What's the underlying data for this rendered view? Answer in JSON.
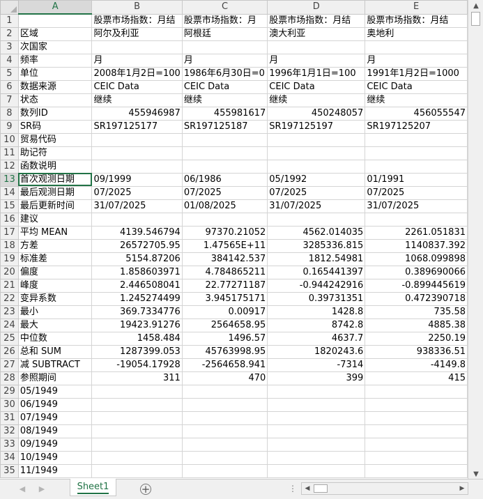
{
  "columns": [
    "A",
    "B",
    "C",
    "D",
    "E"
  ],
  "selected_column": "A",
  "selected_row": 13,
  "rows": [
    {
      "n": "1",
      "a": "",
      "b": "股票市场指数：月结",
      "c": "股票市场指数：月",
      "d": "股票市场指数：月结",
      "e": "股票市场指数：月结"
    },
    {
      "n": "2",
      "a": "区域",
      "b": "阿尔及利亚",
      "c": "阿根廷",
      "d": "澳大利亚",
      "e": "奥地利"
    },
    {
      "n": "3",
      "a": "次国家",
      "b": "",
      "c": "",
      "d": "",
      "e": ""
    },
    {
      "n": "4",
      "a": "频率",
      "b": "月",
      "c": "月",
      "d": "月",
      "e": "月"
    },
    {
      "n": "5",
      "a": "单位",
      "b": "2008年1月2日=100",
      "c": "1986年6月30日=0",
      "d": "1996年1月1日=100",
      "e": "1991年1月2日=1000"
    },
    {
      "n": "6",
      "a": "数据来源",
      "b": "CEIC Data",
      "c": "CEIC Data",
      "d": "CEIC Data",
      "e": "CEIC Data"
    },
    {
      "n": "7",
      "a": "状态",
      "b": "继续",
      "c": "继续",
      "d": "继续",
      "e": "继续"
    },
    {
      "n": "8",
      "a": "数列ID",
      "b": "455946987",
      "c": "455981617",
      "d": "450248057",
      "e": "456055547",
      "num": true
    },
    {
      "n": "9",
      "a": "SR码",
      "b": "SR197125177",
      "c": "SR197125187",
      "d": "SR197125197",
      "e": "SR197125207"
    },
    {
      "n": "10",
      "a": "贸易代码",
      "b": "",
      "c": "",
      "d": "",
      "e": ""
    },
    {
      "n": "11",
      "a": "助记符",
      "b": "",
      "c": "",
      "d": "",
      "e": ""
    },
    {
      "n": "12",
      "a": "函数说明",
      "b": "",
      "c": "",
      "d": "",
      "e": ""
    },
    {
      "n": "13",
      "a": "首次观测日期",
      "b": "09/1999",
      "c": "06/1986",
      "d": "05/1992",
      "e": "01/1991"
    },
    {
      "n": "14",
      "a": "最后观测日期",
      "b": "07/2025",
      "c": "07/2025",
      "d": "07/2025",
      "e": "07/2025"
    },
    {
      "n": "15",
      "a": "最后更新时间",
      "b": "31/07/2025",
      "c": "01/08/2025",
      "d": "31/07/2025",
      "e": "31/07/2025"
    },
    {
      "n": "16",
      "a": "建议",
      "b": "",
      "c": "",
      "d": "",
      "e": ""
    },
    {
      "n": "17",
      "a": "平均 MEAN",
      "b": "4139.546794",
      "c": "97370.21052",
      "d": "4562.014035",
      "e": "2261.051831",
      "num": true
    },
    {
      "n": "18",
      "a": "方差",
      "b": "26572705.95",
      "c": "1.47565E+11",
      "d": "3285336.815",
      "e": "1140837.392",
      "num": true
    },
    {
      "n": "19",
      "a": "标准差",
      "b": "5154.87206",
      "c": "384142.537",
      "d": "1812.54981",
      "e": "1068.099898",
      "num": true
    },
    {
      "n": "20",
      "a": "偏度",
      "b": "1.858603971",
      "c": "4.784865211",
      "d": "0.165441397",
      "e": "0.389690066",
      "num": true
    },
    {
      "n": "21",
      "a": "峰度",
      "b": "2.446508041",
      "c": "22.77271187",
      "d": "-0.944242916",
      "e": "-0.899445619",
      "num": true
    },
    {
      "n": "22",
      "a": "变异系数",
      "b": "1.245274499",
      "c": "3.945175171",
      "d": "0.39731351",
      "e": "0.472390718",
      "num": true
    },
    {
      "n": "23",
      "a": "最小",
      "b": "369.7334776",
      "c": "0.00917",
      "d": "1428.8",
      "e": "735.58",
      "num": true
    },
    {
      "n": "24",
      "a": "最大",
      "b": "19423.91276",
      "c": "2564658.95",
      "d": "8742.8",
      "e": "4885.38",
      "num": true
    },
    {
      "n": "25",
      "a": "中位数",
      "b": "1458.484",
      "c": "1496.57",
      "d": "4637.7",
      "e": "2250.19",
      "num": true
    },
    {
      "n": "26",
      "a": "总和 SUM",
      "b": "1287399.053",
      "c": "45763998.95",
      "d": "1820243.6",
      "e": "938336.51",
      "num": true
    },
    {
      "n": "27",
      "a": "减 SUBTRACT",
      "b": "-19054.17928",
      "c": "-2564658.941",
      "d": "-7314",
      "e": "-4149.8",
      "num": true
    },
    {
      "n": "28",
      "a": "参照期间",
      "b": "311",
      "c": "470",
      "d": "399",
      "e": "415",
      "num": true
    },
    {
      "n": "29",
      "a": "05/1949",
      "b": "",
      "c": "",
      "d": "",
      "e": ""
    },
    {
      "n": "30",
      "a": "06/1949",
      "b": "",
      "c": "",
      "d": "",
      "e": ""
    },
    {
      "n": "31",
      "a": "07/1949",
      "b": "",
      "c": "",
      "d": "",
      "e": ""
    },
    {
      "n": "32",
      "a": "08/1949",
      "b": "",
      "c": "",
      "d": "",
      "e": ""
    },
    {
      "n": "33",
      "a": "09/1949",
      "b": "",
      "c": "",
      "d": "",
      "e": ""
    },
    {
      "n": "34",
      "a": "10/1949",
      "b": "",
      "c": "",
      "d": "",
      "e": ""
    },
    {
      "n": "35",
      "a": "11/1949",
      "b": "",
      "c": "",
      "d": "",
      "e": ""
    }
  ],
  "sheet_tab": "Sheet1",
  "icons": {
    "add_sheet": "+",
    "scroll_up": "▲",
    "scroll_down": "▼",
    "scroll_left": "◀",
    "scroll_right": "▶",
    "tab_prev": "◀",
    "tab_next": "▶",
    "more": "⋮"
  },
  "colors": {
    "accent": "#217346",
    "header_bg": "#f0f0f0",
    "grid": "#d4d4d4"
  }
}
